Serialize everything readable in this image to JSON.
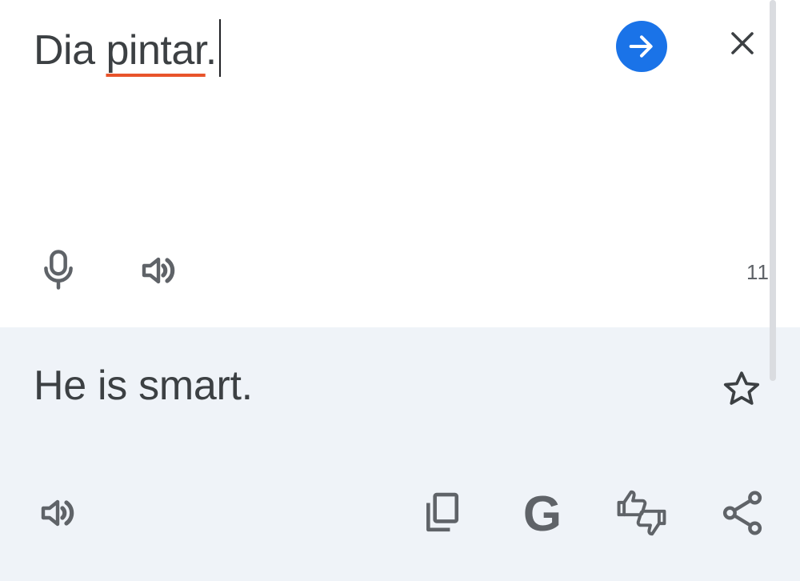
{
  "source": {
    "text_word1": "Dia ",
    "text_word2_misspelled": "pintar",
    "text_punct": ".",
    "char_count": "11"
  },
  "result": {
    "text": "He is smart."
  },
  "icons": {
    "go": "arrow-forward-icon",
    "clear": "close-icon",
    "mic": "microphone-icon",
    "source_speaker": "volume-icon",
    "star": "star-outline-icon",
    "result_speaker": "volume-icon",
    "copy": "copy-icon",
    "google": "google-g-icon",
    "feedback": "thumbs-feedback-icon",
    "share": "share-icon"
  },
  "google_letter": "G",
  "colors": {
    "accent": "#1a73e8",
    "spellcheck_underline": "#e8542b",
    "result_background": "#eff3f8",
    "icon": "#5f6368"
  }
}
